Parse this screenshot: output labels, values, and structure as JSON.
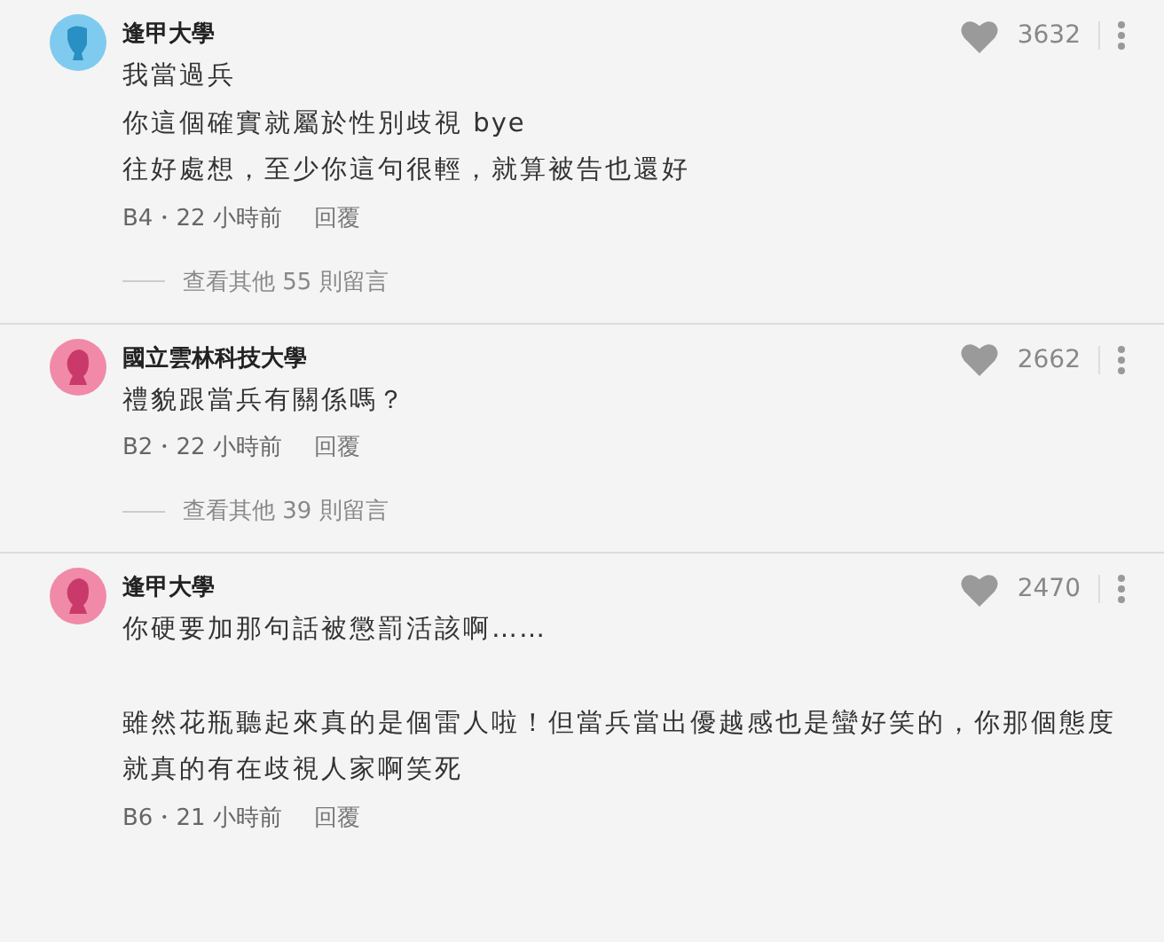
{
  "comments": [
    {
      "author": "逢甲大學",
      "kind": "male",
      "likes": "3632",
      "paragraphs": [
        [
          "我當過兵",
          "你這個確實就屬於性別歧視  bye",
          "往好處想，至少你這句很輕，就算被告也還好"
        ]
      ],
      "post_info": "B4・22 小時前",
      "reply": "回覆",
      "more_replies": "查看其他 55 則留言"
    },
    {
      "author": "國立雲林科技大學",
      "kind": "female",
      "likes": "2662",
      "paragraphs": [
        [
          "禮貌跟當兵有關係嗎？"
        ]
      ],
      "post_info": "B2・22 小時前",
      "reply": "回覆",
      "more_replies": "查看其他 39 則留言"
    },
    {
      "author": "逢甲大學",
      "kind": "female",
      "likes": "2470",
      "paragraphs": [
        [
          "你硬要加那句話被懲罰活該啊……"
        ],
        [
          "雖然花瓶聽起來真的是個雷人啦！但當兵當出優越感也是蠻好笑的，你那個態度",
          "就真的有在歧視人家啊笑死"
        ]
      ],
      "post_info": "B6・21 小時前",
      "reply": "回覆"
    }
  ]
}
